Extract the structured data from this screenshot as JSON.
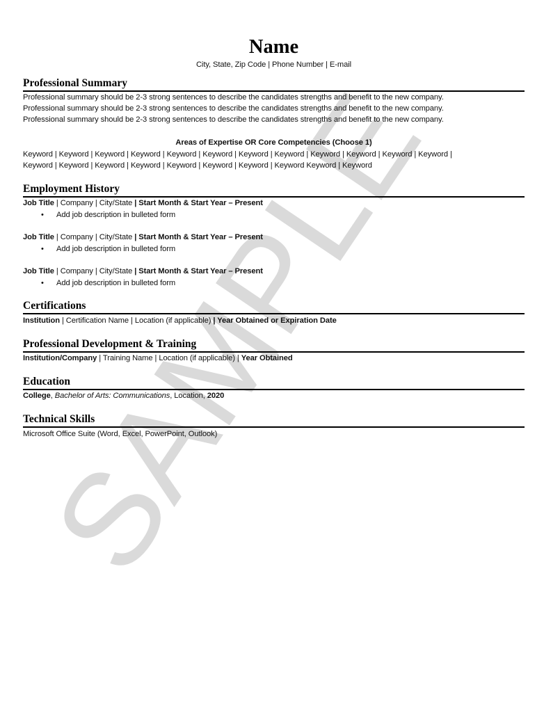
{
  "header": {
    "name": "Name",
    "contact": "City, State, Zip Code | Phone Number | E-mail"
  },
  "watermark": {
    "text": "SAMPLE",
    "color": "#dadada"
  },
  "summary": {
    "title": "Professional Summary",
    "lines": [
      "Professional summary should be 2-3 strong sentences to describe the candidates strengths and benefit to the new company.",
      "Professional summary should be 2-3 strong sentences to describe the candidates strengths and benefit to the new company.",
      "Professional summary should be 2-3 strong sentences to describe the candidates strengths and benefit to the new company."
    ],
    "expertise_title": "Areas of Expertise OR Core Competencies (Choose 1)",
    "keyword_lines": [
      "Keyword | Keyword | Keyword | Keyword | Keyword | Keyword | Keyword | Keyword | Keyword | Keyword | Keyword | Keyword |",
      "Keyword | Keyword | Keyword | Keyword | Keyword | Keyword | Keyword | Keyword Keyword | Keyword"
    ]
  },
  "employment": {
    "title": "Employment History",
    "jobs": [
      {
        "job_title": "Job Title",
        "sep1": " | Company | City/State ",
        "dates": "| Start Month & Start Year – Present",
        "bullet": "Add job description in bulleted form"
      },
      {
        "job_title": "Job Title",
        "sep1": " | Company | City/State ",
        "dates": "| Start Month & Start Year – Present",
        "bullet": "Add job description in bulleted form"
      },
      {
        "job_title": "Job Title",
        "sep1": " | Company | City/State ",
        "dates": "| Start Month & Start Year – Present",
        "bullet": "Add job description in bulleted form"
      }
    ],
    "bullet_glyph": "•"
  },
  "certifications": {
    "title": "Certifications",
    "institution": "Institution",
    "middle": " | Certification Name | Location (if applicable) ",
    "date": "| Year Obtained or Expiration Date"
  },
  "training": {
    "title": "Professional Development & Training",
    "institution": "Institution/Company",
    "middle": " | Training Name | Location (if applicable) | ",
    "date": "Year Obtained"
  },
  "education": {
    "title": "Education",
    "college": "College",
    "comma1": ", ",
    "degree": "Bachelor of Arts: Communications",
    "location": ", Location, ",
    "year": "2020"
  },
  "skills": {
    "title": "Technical Skills",
    "text": "Microsoft Office Suite (Word, Excel, PowerPoint, Outlook)"
  }
}
